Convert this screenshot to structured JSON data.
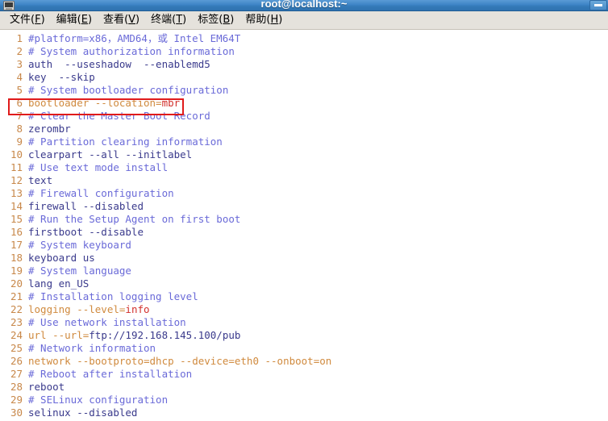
{
  "window": {
    "title": "root@localhost:~",
    "icon": "terminal-icon",
    "minimize_label": "–"
  },
  "menubar": {
    "items": [
      {
        "name": "file",
        "label": "文件",
        "accel": "F"
      },
      {
        "name": "edit",
        "label": "编辑",
        "accel": "E"
      },
      {
        "name": "view",
        "label": "查看",
        "accel": "V"
      },
      {
        "name": "terminal",
        "label": "终端",
        "accel": "T"
      },
      {
        "name": "tabs",
        "label": "标签",
        "accel": "B"
      },
      {
        "name": "help",
        "label": "帮助",
        "accel": "H"
      }
    ]
  },
  "editor": {
    "highlight": {
      "line": 4,
      "color": "#e01b1b"
    },
    "lines": [
      {
        "n": "1",
        "segments": [
          {
            "t": "#platform=x86，AMD64，或 Intel EM64T",
            "c": "c-comment"
          }
        ]
      },
      {
        "n": "2",
        "segments": [
          {
            "t": "# System authorization information",
            "c": "c-comment"
          }
        ]
      },
      {
        "n": "3",
        "segments": [
          {
            "t": "auth  --useshadow  --enablemd5",
            "c": "c-code"
          }
        ]
      },
      {
        "n": "4",
        "segments": [
          {
            "t": "key  --skip",
            "c": "c-code"
          }
        ]
      },
      {
        "n": "5",
        "segments": [
          {
            "t": "# System bootloader configuration",
            "c": "c-comment"
          }
        ]
      },
      {
        "n": "6",
        "segments": [
          {
            "t": "bootloader --location=",
            "c": "c-orange"
          },
          {
            "t": "mbr",
            "c": "c-red"
          }
        ]
      },
      {
        "n": "7",
        "segments": [
          {
            "t": "# Clear the Master Boot Record",
            "c": "c-comment"
          }
        ]
      },
      {
        "n": "8",
        "segments": [
          {
            "t": "zerombr",
            "c": "c-code"
          }
        ]
      },
      {
        "n": "9",
        "segments": [
          {
            "t": "# Partition clearing information",
            "c": "c-comment"
          }
        ]
      },
      {
        "n": "10",
        "segments": [
          {
            "t": "clearpart --all --initlabel",
            "c": "c-code"
          }
        ]
      },
      {
        "n": "11",
        "segments": [
          {
            "t": "# Use text mode install",
            "c": "c-comment"
          }
        ]
      },
      {
        "n": "12",
        "segments": [
          {
            "t": "text",
            "c": "c-code"
          }
        ]
      },
      {
        "n": "13",
        "segments": [
          {
            "t": "# Firewall configuration",
            "c": "c-comment"
          }
        ]
      },
      {
        "n": "14",
        "segments": [
          {
            "t": "firewall --disabled",
            "c": "c-code"
          }
        ]
      },
      {
        "n": "15",
        "segments": [
          {
            "t": "# Run the Setup Agent on first boot",
            "c": "c-comment"
          }
        ]
      },
      {
        "n": "16",
        "segments": [
          {
            "t": "firstboot --disable",
            "c": "c-code"
          }
        ]
      },
      {
        "n": "17",
        "segments": [
          {
            "t": "# System keyboard",
            "c": "c-comment"
          }
        ]
      },
      {
        "n": "18",
        "segments": [
          {
            "t": "keyboard us",
            "c": "c-code"
          }
        ]
      },
      {
        "n": "19",
        "segments": [
          {
            "t": "# System language",
            "c": "c-comment"
          }
        ]
      },
      {
        "n": "20",
        "segments": [
          {
            "t": "lang en_US",
            "c": "c-code"
          }
        ]
      },
      {
        "n": "21",
        "segments": [
          {
            "t": "# Installation logging level",
            "c": "c-comment"
          }
        ]
      },
      {
        "n": "22",
        "segments": [
          {
            "t": "logging --level=",
            "c": "c-orange"
          },
          {
            "t": "info",
            "c": "c-red"
          }
        ]
      },
      {
        "n": "23",
        "segments": [
          {
            "t": "# Use network installation",
            "c": "c-comment"
          }
        ]
      },
      {
        "n": "24",
        "segments": [
          {
            "t": "url --url=",
            "c": "c-orange"
          },
          {
            "t": "ftp://192.168.145.100/pub",
            "c": "c-code"
          }
        ]
      },
      {
        "n": "25",
        "segments": [
          {
            "t": "# Network information",
            "c": "c-comment"
          }
        ]
      },
      {
        "n": "26",
        "segments": [
          {
            "t": "network --bootproto=dhcp --device=eth0 --onboot=on",
            "c": "c-orange"
          }
        ]
      },
      {
        "n": "27",
        "segments": [
          {
            "t": "# Reboot after installation",
            "c": "c-comment"
          }
        ]
      },
      {
        "n": "28",
        "segments": [
          {
            "t": "reboot",
            "c": "c-code"
          }
        ]
      },
      {
        "n": "29",
        "segments": [
          {
            "t": "# SELinux configuration",
            "c": "c-comment"
          }
        ]
      },
      {
        "n": "30",
        "segments": [
          {
            "t": "selinux --disabled",
            "c": "c-code"
          }
        ]
      }
    ]
  }
}
